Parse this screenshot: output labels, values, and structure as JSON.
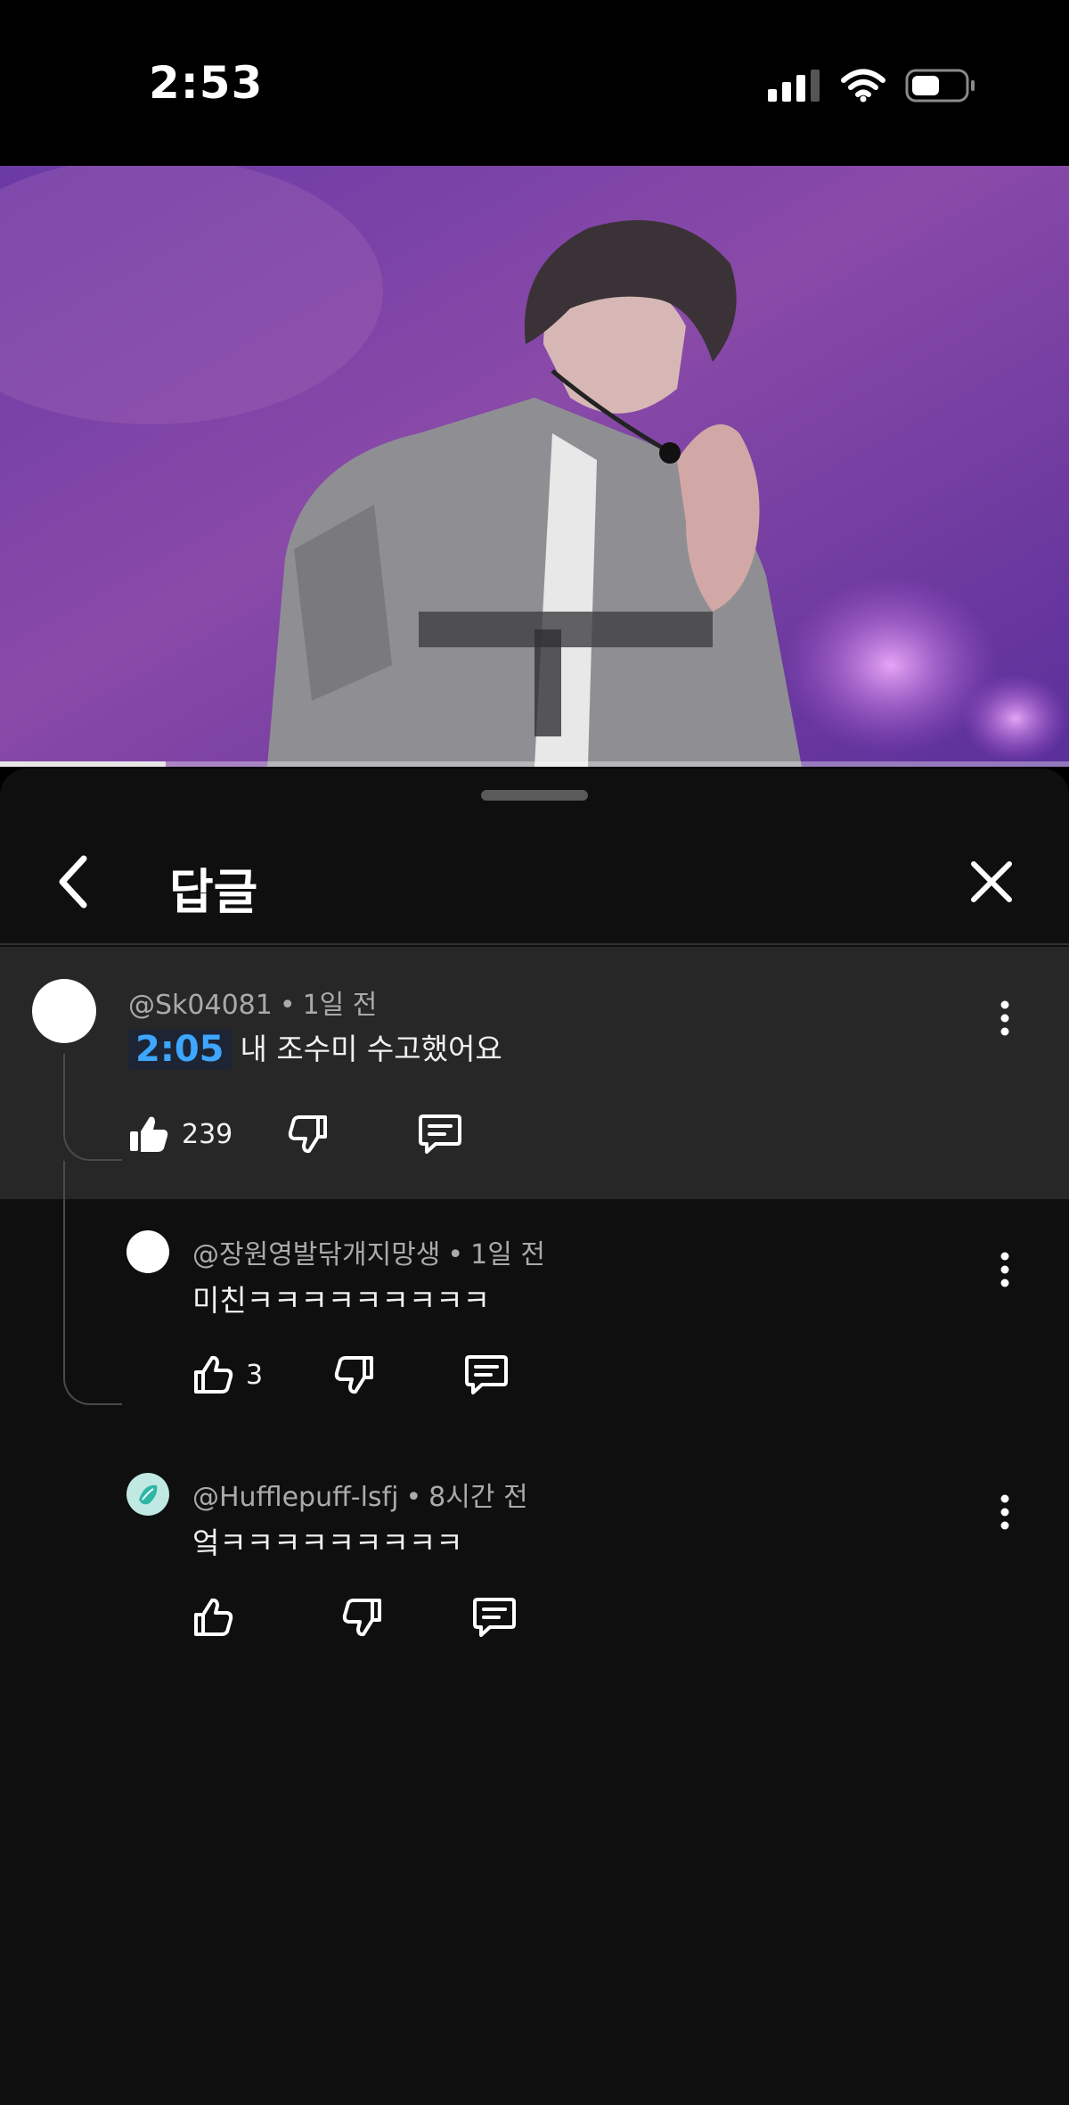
{
  "status_bar": {
    "time": "2:53"
  },
  "video": {
    "progress_fraction": 0.155
  },
  "sheet": {
    "title": "답글"
  },
  "parent_comment": {
    "author": "@Sk04081",
    "age": "1일 전",
    "timestamp_link": "2:05",
    "text": "내 조수미 수고했어요",
    "likes": "239"
  },
  "replies": [
    {
      "author": "@장원영발닦개지망생",
      "age": "1일 전",
      "text": "미친ㅋㅋㅋㅋㅋㅋㅋㅋㅋ",
      "likes": "3"
    },
    {
      "author": "@Hufflepuff-lsfj",
      "age": "8시간 전",
      "text": "엌ㅋㅋㅋㅋㅋㅋㅋㅋㅋ",
      "likes": ""
    }
  ],
  "colors": {
    "accent_link": "#3ea6ff",
    "sheet_bg": "#0f0f0f",
    "highlight_bg": "#272727"
  }
}
